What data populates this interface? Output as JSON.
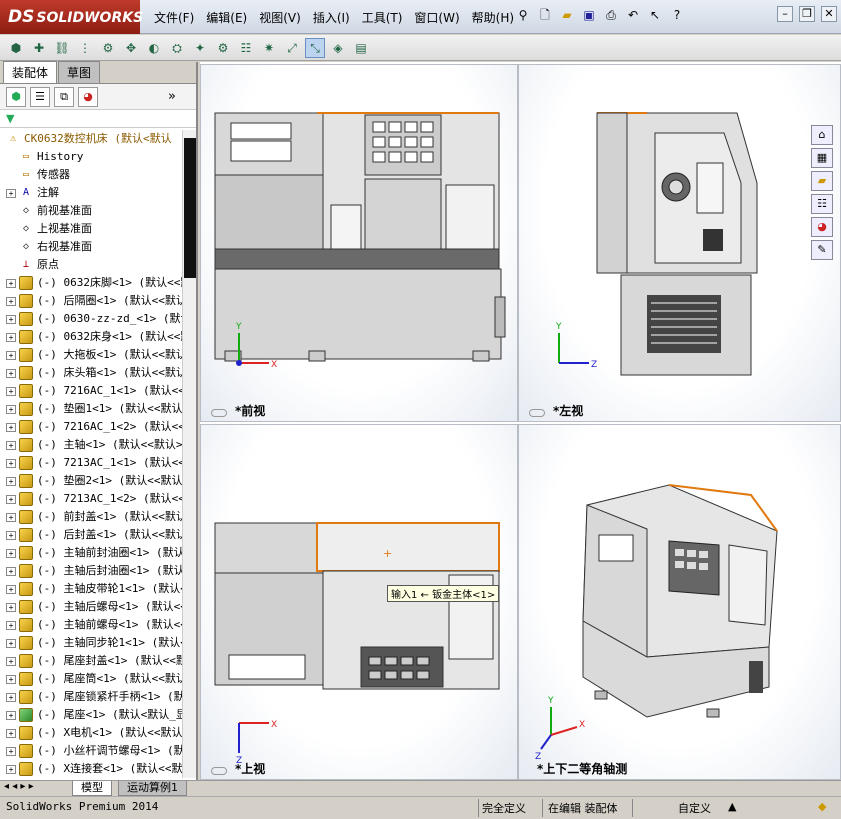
{
  "app": {
    "brand": "SOLIDWORKS",
    "brand_prefix": "DS"
  },
  "menu": [
    "文件(F)",
    "编辑(E)",
    "视图(V)",
    "插入(I)",
    "工具(T)",
    "窗口(W)",
    "帮助(H)"
  ],
  "panel_tabs": [
    "装配体",
    "草图"
  ],
  "tree": {
    "root": "CK0632数控机床 (默认<默认",
    "items": [
      {
        "label": "History",
        "kind": "folder",
        "exp": false
      },
      {
        "label": "传感器",
        "kind": "folder",
        "exp": false
      },
      {
        "label": "注解",
        "kind": "annot",
        "exp": true
      },
      {
        "label": "前视基准面",
        "kind": "plane",
        "exp": false
      },
      {
        "label": "上视基准面",
        "kind": "plane",
        "exp": false
      },
      {
        "label": "右视基准面",
        "kind": "plane",
        "exp": false
      },
      {
        "label": "原点",
        "kind": "origin",
        "exp": false
      },
      {
        "label": "(-) 0632床脚<1> (默认<<默认",
        "kind": "part",
        "exp": true
      },
      {
        "label": "(-) 后隔圈<1> (默认<<默认",
        "kind": "part",
        "exp": true
      },
      {
        "label": "(-) 0630-zz-zd_<1> (默认<",
        "kind": "part",
        "exp": true
      },
      {
        "label": "(-) 0632床身<1> (默认<<默",
        "kind": "part",
        "exp": true
      },
      {
        "label": "(-) 大拖板<1> (默认<<默认",
        "kind": "part",
        "exp": true
      },
      {
        "label": "(-) 床头箱<1> (默认<<默认",
        "kind": "part",
        "exp": true
      },
      {
        "label": "(-) 7216AC_1<1> (默认<<",
        "kind": "part",
        "exp": true
      },
      {
        "label": "(-) 垫圈1<1> (默认<<默认>",
        "kind": "part",
        "exp": true
      },
      {
        "label": "(-) 7216AC_1<2> (默认<<",
        "kind": "part",
        "exp": true
      },
      {
        "label": "(-) 主轴<1> (默认<<默认>_",
        "kind": "part",
        "exp": true
      },
      {
        "label": "(-) 7213AC_1<1> (默认<<默",
        "kind": "part",
        "exp": true
      },
      {
        "label": "(-) 垫圈2<1> (默认<<默认>",
        "kind": "part",
        "exp": true
      },
      {
        "label": "(-) 7213AC_1<2> (默认<<默",
        "kind": "part",
        "exp": true
      },
      {
        "label": "(-) 前封盖<1> (默认<<默认",
        "kind": "part",
        "exp": true
      },
      {
        "label": "(-) 后封盖<1> (默认<<默认",
        "kind": "part",
        "exp": true
      },
      {
        "label": "(-) 主轴前封油圈<1> (默认<",
        "kind": "part",
        "exp": true
      },
      {
        "label": "(-) 主轴后封油圈<1> (默认<",
        "kind": "part",
        "exp": true
      },
      {
        "label": "(-) 主轴皮带轮1<1> (默认<",
        "kind": "part",
        "exp": true
      },
      {
        "label": "(-) 主轴后螺母<1> (默认<<",
        "kind": "part",
        "exp": true
      },
      {
        "label": "(-) 主轴前螺母<1> (默认<<",
        "kind": "part",
        "exp": true
      },
      {
        "label": "(-) 主轴同步轮1<1> (默认<",
        "kind": "part",
        "exp": true
      },
      {
        "label": "(-) 尾座封盖<1> (默认<<默",
        "kind": "part",
        "exp": true
      },
      {
        "label": "(-) 尾座筒<1> (默认<<默认",
        "kind": "part",
        "exp": true
      },
      {
        "label": "(-) 尾座锁紧杆手柄<1> (默认",
        "kind": "part",
        "exp": true
      },
      {
        "label": "(-) 尾座<1> (默认<默认_显",
        "kind": "asm",
        "exp": true
      },
      {
        "label": "(-) X电机<1> (默认<<默认>",
        "kind": "part",
        "exp": true
      },
      {
        "label": "(-) 小丝杆调节螺母<1> (默",
        "kind": "part",
        "exp": true
      },
      {
        "label": "(-) X连接套<1> (默认<<默认",
        "kind": "part",
        "exp": true
      }
    ]
  },
  "viewports": [
    {
      "label": "*前视",
      "axis": [
        "Y",
        "X"
      ]
    },
    {
      "label": "*左视",
      "axis": [
        "Y",
        "Z"
      ]
    },
    {
      "label": "*上视",
      "axis": [
        "X",
        "Z"
      ]
    },
    {
      "label": "*上下二等角轴测",
      "axis": [
        "Y",
        "X",
        "Z"
      ]
    }
  ],
  "tooltip": "输入1 ← 钣金主体<1>",
  "bottom_tabs": [
    "模型",
    "运动算例1"
  ],
  "status": {
    "app": "SolidWorks Premium 2014",
    "def": "完全定义",
    "edit": "在编辑 装配体",
    "custom": "自定义"
  },
  "colors": {
    "brand": "#b5301f",
    "selection": "#e07a10",
    "axis_x": "#d22",
    "axis_y": "#1a1",
    "axis_z": "#22c"
  }
}
